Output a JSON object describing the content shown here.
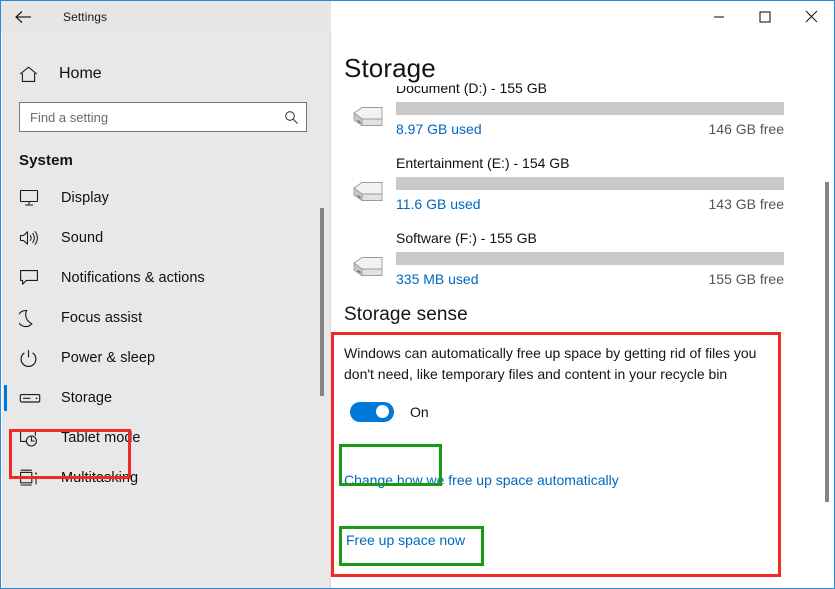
{
  "window": {
    "title": "Settings",
    "back_icon": "back-arrow-icon",
    "minimize_label": "–",
    "maximize_label": "□",
    "close_label": "✕"
  },
  "sidebar": {
    "home_label": "Home",
    "home_icon": "home-icon",
    "search": {
      "placeholder": "Find a setting",
      "value": "",
      "icon": "search-icon"
    },
    "group_header": "System",
    "items": [
      {
        "label": "Display",
        "icon": "monitor-icon",
        "selected": false
      },
      {
        "label": "Sound",
        "icon": "speaker-icon",
        "selected": false
      },
      {
        "label": "Notifications & actions",
        "icon": "speech-bubble-icon",
        "selected": false
      },
      {
        "label": "Focus assist",
        "icon": "moon-icon",
        "selected": false
      },
      {
        "label": "Power & sleep",
        "icon": "power-icon",
        "selected": false
      },
      {
        "label": "Storage",
        "icon": "drive-icon",
        "selected": true
      },
      {
        "label": "Tablet mode",
        "icon": "tablet-icon",
        "selected": false
      },
      {
        "label": "Multitasking",
        "icon": "multitasking-icon",
        "selected": false
      }
    ]
  },
  "main": {
    "page_title": "Storage",
    "drives": [
      {
        "name": "Document (D:) - 155 GB",
        "used": "8.97 GB used",
        "free": "146 GB free",
        "used_percent": 6
      },
      {
        "name": "Entertainment (E:) - 154 GB",
        "used": "11.6 GB used",
        "free": "143 GB free",
        "used_percent": 7.5
      },
      {
        "name": "Software (F:) - 155 GB",
        "used": "335 MB used",
        "free": "155 GB free",
        "used_percent": 0
      }
    ],
    "storage_sense": {
      "title": "Storage sense",
      "description": "Windows can automatically free up space by getting rid of files you don't need, like temporary files and content in your recycle bin",
      "toggle_state": "On",
      "toggle_on": true,
      "link_change": "Change how we free up space automatically",
      "link_free_up": "Free up space now"
    }
  },
  "colors": {
    "accent": "#0078d7",
    "link": "#0067c0",
    "annotation_red": "#ee2b26",
    "annotation_green": "#199a19",
    "bar_track": "#c9c9c9",
    "sidebar_bg": "#e8e8e8"
  }
}
